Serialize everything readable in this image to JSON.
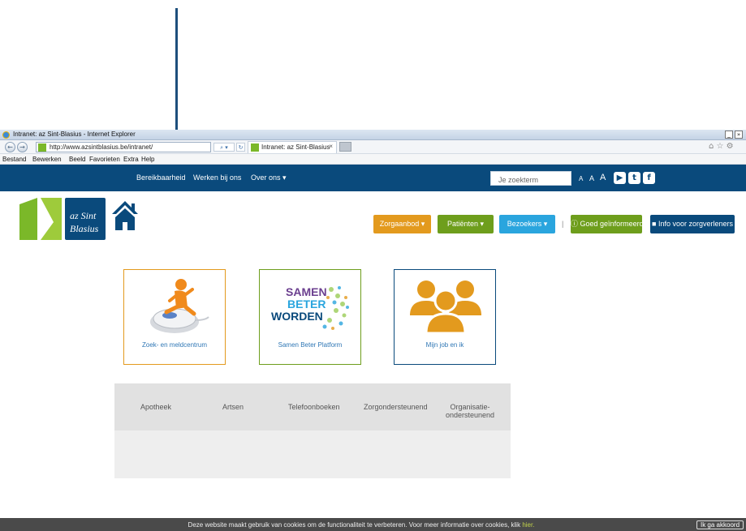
{
  "browser": {
    "window_title": "Intranet: az Sint-Blasius - Internet Explorer",
    "window_buttons": [
      "_",
      "»"
    ],
    "url": "http://www.azsintblasius.be/intranet/",
    "address_tools": "⌕ ▾",
    "refresh": "↻",
    "tab_title": "Intranet: az Sint-Blasius",
    "tab_close": "×",
    "right_icons": "⌂ ☆ ⚙",
    "menu": [
      "Bestand",
      "Bewerken",
      "Beeld",
      "Favorieten",
      "Extra",
      "Help"
    ]
  },
  "topnav": {
    "links": [
      "Bereikbaarheid",
      "Werken bij ons",
      "Over ons ▾"
    ],
    "search_placeholder": "Je zoekterm",
    "font_sizes": [
      "A",
      "A",
      "A"
    ],
    "social": [
      "▶",
      "t",
      "f"
    ]
  },
  "logo": {
    "text_line1": "az Sint",
    "text_line2": "Blasius",
    "colors": {
      "green": "#7bb829",
      "blue": "#0a4a7c"
    }
  },
  "buttons": {
    "zorgaanbod": "Zorgaanbod ▾",
    "patienten": "Patiënten ▾",
    "bezoekers": "Bezoekers ▾",
    "separator": "|",
    "goed_geinformeerd": "Goed geïnformeerd",
    "info_zorgverleners": "Info voor zorgverleners",
    "colors": {
      "orange": "#e39a1e",
      "green": "#6e9e1c",
      "lightblue": "#2aa5de",
      "darkblue": "#0a4a7c"
    }
  },
  "tiles": [
    {
      "label": "Zoek- en meldcentrum",
      "border": "#e39a1e"
    },
    {
      "label": "Samen Beter Platform",
      "border": "#6e9e1c",
      "image_text": [
        "SAMEN",
        "BETER",
        "WORDEN"
      ]
    },
    {
      "label": "Mijn job en ik",
      "border": "#0a4a7c"
    }
  ],
  "quicklinks": [
    "Apotheek",
    "Artsen",
    "Telefoonboeken",
    "Zorgondersteunend",
    "Organisatie-",
    "ondersteunend"
  ],
  "cookie": {
    "text": "Deze website maakt gebruik van cookies om de functionaliteit te verbeteren. Voor meer informatie over cookies, klik ",
    "link": "hier.",
    "button": "Ik ga akkoord"
  }
}
